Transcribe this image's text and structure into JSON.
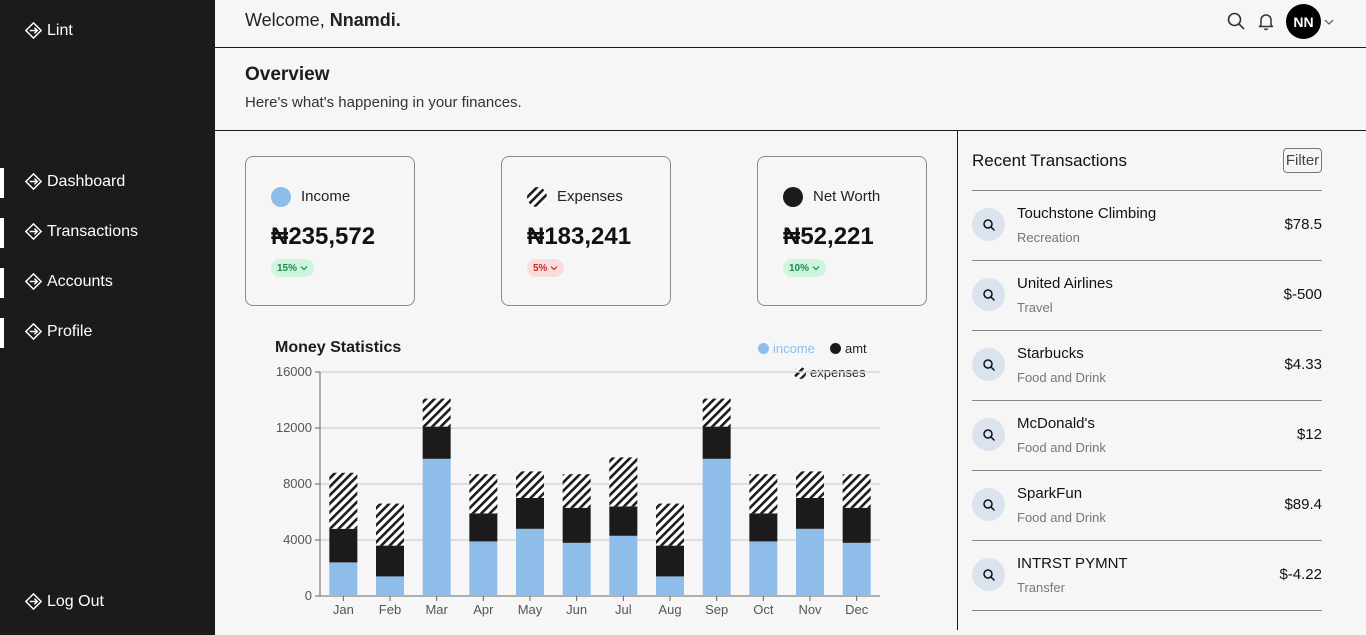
{
  "sidebar": {
    "brand": "Lint",
    "items": [
      {
        "label": "Dashboard"
      },
      {
        "label": "Transactions"
      },
      {
        "label": "Accounts"
      },
      {
        "label": "Profile"
      }
    ],
    "logout": "Log Out"
  },
  "header": {
    "welcome": "Welcome,",
    "user_name": "Nnamdi.",
    "avatar_initials": "NN"
  },
  "overview": {
    "title": "Overview",
    "subtitle": "Here's what's happening in your finances."
  },
  "cards": [
    {
      "label": "Income",
      "amount": "₦235,572",
      "change": "15%",
      "trend": "up",
      "color": "#8fbde9"
    },
    {
      "label": "Expenses",
      "amount": "₦183,241",
      "change": "5%",
      "trend": "down",
      "color": "hatch"
    },
    {
      "label": "Net Worth",
      "amount": "₦52,221",
      "change": "10%",
      "trend": "up",
      "color": "#1c1a1b"
    }
  ],
  "chart_data": {
    "type": "bar",
    "stacked": true,
    "title": "Money Statistics",
    "categories": [
      "Jan",
      "Feb",
      "Mar",
      "Apr",
      "May",
      "Jun",
      "Jul",
      "Aug",
      "Sep",
      "Oct",
      "Nov",
      "Dec"
    ],
    "series": [
      {
        "name": "income",
        "color": "#8fbde9",
        "values": [
          2400,
          1400,
          9800,
          3900,
          4800,
          3800,
          4300,
          1400,
          9800,
          3900,
          4800,
          3800
        ]
      },
      {
        "name": "amt",
        "color": "#1c1a1b",
        "values": [
          2400,
          2200,
          2300,
          2000,
          2200,
          2500,
          2100,
          2200,
          2300,
          2000,
          2200,
          2500
        ]
      },
      {
        "name": "expenses",
        "color": "hatch",
        "values": [
          4000,
          3000,
          2000,
          2800,
          1900,
          2400,
          3500,
          3000,
          2000,
          2800,
          1900,
          2400
        ]
      }
    ],
    "yticks": [
      0,
      4000,
      8000,
      12000,
      16000
    ],
    "ylim": [
      0,
      16000
    ],
    "grid": true,
    "legend_position": "top-right"
  },
  "transactions": {
    "title": "Recent Transactions",
    "filter_label": "Filter",
    "items": [
      {
        "name": "Touchstone Climbing",
        "category": "Recreation",
        "amount": "$78.5"
      },
      {
        "name": "United Airlines",
        "category": "Travel",
        "amount": "$-500"
      },
      {
        "name": "Starbucks",
        "category": "Food and Drink",
        "amount": "$4.33"
      },
      {
        "name": "McDonald's",
        "category": "Food and Drink",
        "amount": "$12"
      },
      {
        "name": "SparkFun",
        "category": "Food and Drink",
        "amount": "$89.4"
      },
      {
        "name": "INTRST PYMNT",
        "category": "Transfer",
        "amount": "$-4.22"
      }
    ]
  }
}
